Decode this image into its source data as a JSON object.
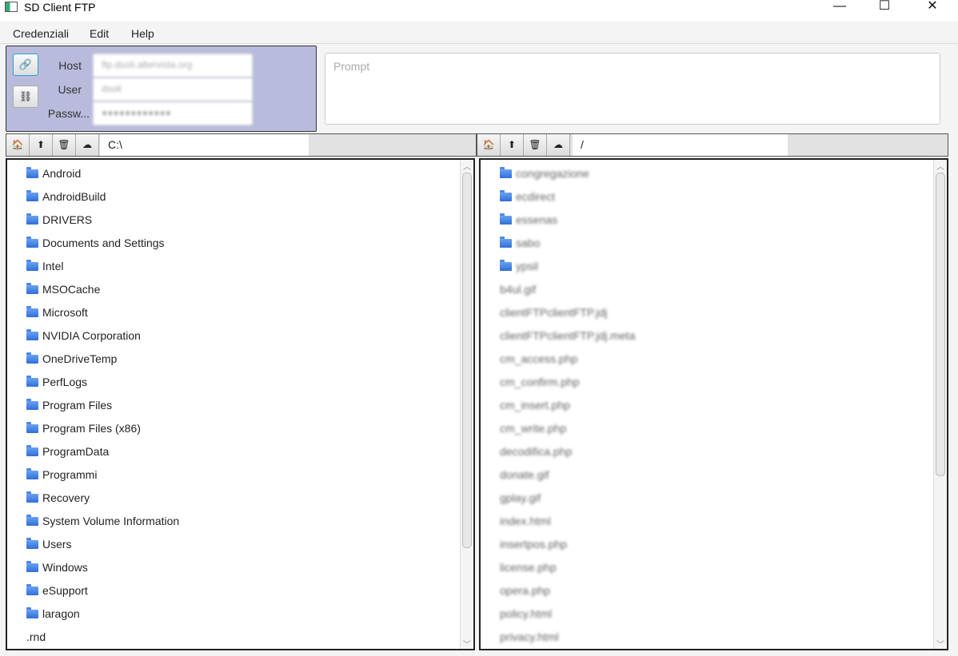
{
  "window": {
    "title": "SD Client FTP",
    "minimize": "—",
    "maximize": "☐",
    "close": "✕"
  },
  "menu": [
    "Credenziali",
    "Edit",
    "Help"
  ],
  "login": {
    "host_label": "Host",
    "user_label": "User",
    "password_label": "Passw...",
    "host_value": "ftp.dsoli.altervista.org",
    "user_value": "dsoli",
    "password_value": "●●●●●●●●●●●●",
    "connect_icon": "🔗",
    "disconnect_icon": "⛓"
  },
  "prompt": {
    "placeholder": "Prompt"
  },
  "local": {
    "path": "C:\\",
    "items": [
      {
        "name": "Android",
        "folder": true
      },
      {
        "name": "AndroidBuild",
        "folder": true
      },
      {
        "name": "DRIVERS",
        "folder": true
      },
      {
        "name": "Documents and Settings",
        "folder": true
      },
      {
        "name": "Intel",
        "folder": true
      },
      {
        "name": "MSOCache",
        "folder": true
      },
      {
        "name": "Microsoft",
        "folder": true
      },
      {
        "name": "NVIDIA Corporation",
        "folder": true
      },
      {
        "name": "OneDriveTemp",
        "folder": true
      },
      {
        "name": "PerfLogs",
        "folder": true
      },
      {
        "name": "Program Files",
        "folder": true
      },
      {
        "name": "Program Files (x86)",
        "folder": true
      },
      {
        "name": "ProgramData",
        "folder": true
      },
      {
        "name": "Programmi",
        "folder": true
      },
      {
        "name": "Recovery",
        "folder": true
      },
      {
        "name": "System Volume Information",
        "folder": true
      },
      {
        "name": "Users",
        "folder": true
      },
      {
        "name": "Windows",
        "folder": true
      },
      {
        "name": "eSupport",
        "folder": true
      },
      {
        "name": "laragon",
        "folder": true
      },
      {
        "name": ".rnd",
        "folder": false
      }
    ]
  },
  "remote": {
    "path": "/",
    "items": [
      {
        "name": "congregazione",
        "folder": true
      },
      {
        "name": "ecdirect",
        "folder": true
      },
      {
        "name": "essenas",
        "folder": true
      },
      {
        "name": "sabo",
        "folder": true
      },
      {
        "name": "ypsil",
        "folder": true
      },
      {
        "name": "b4ul.gif",
        "folder": false
      },
      {
        "name": "clientFTPclientFTP.jdj",
        "folder": false
      },
      {
        "name": "clientFTPclientFTP.jdj.meta",
        "folder": false
      },
      {
        "name": "cm_access.php",
        "folder": false
      },
      {
        "name": "cm_confirm.php",
        "folder": false
      },
      {
        "name": "cm_insert.php",
        "folder": false
      },
      {
        "name": "cm_write.php",
        "folder": false
      },
      {
        "name": "decodifica.php",
        "folder": false
      },
      {
        "name": "donate.gif",
        "folder": false
      },
      {
        "name": "gplay.gif",
        "folder": false
      },
      {
        "name": "index.html",
        "folder": false
      },
      {
        "name": "insertpos.php",
        "folder": false
      },
      {
        "name": "license.php",
        "folder": false
      },
      {
        "name": "opera.php",
        "folder": false
      },
      {
        "name": "policy.html",
        "folder": false
      },
      {
        "name": "privacy.html",
        "folder": false
      }
    ]
  },
  "toolbar": {
    "home": "🏠",
    "up": "⬆",
    "delete": "🗑",
    "cloud": "☁"
  }
}
